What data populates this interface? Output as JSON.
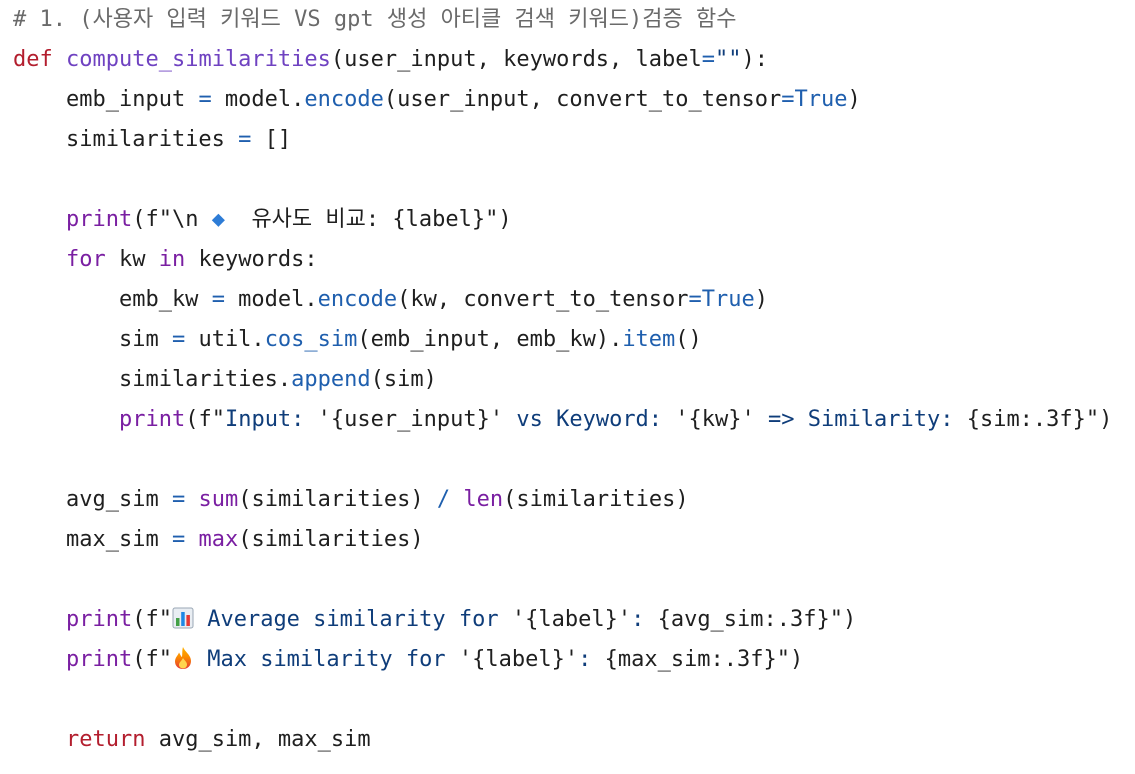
{
  "editor": {
    "lines": [
      {
        "tokens": [
          {
            "t": "# 1. (사용자 입력 키워드 VS gpt 생성 아티클 검색 키워드)검증 함수",
            "c": "comment"
          }
        ]
      },
      {
        "tokens": [
          {
            "t": "def",
            "c": "keyword"
          },
          {
            "t": " ",
            "c": "plain"
          },
          {
            "t": "compute_similarities",
            "c": "funcdef"
          },
          {
            "t": "(user_input, keywords, label",
            "c": "plain"
          },
          {
            "t": "=",
            "c": "operator"
          },
          {
            "t": "\"\"",
            "c": "string"
          },
          {
            "t": "):",
            "c": "plain"
          }
        ]
      },
      {
        "tokens": [
          {
            "t": "    emb_input ",
            "c": "plain"
          },
          {
            "t": "=",
            "c": "operator"
          },
          {
            "t": " model.",
            "c": "plain"
          },
          {
            "t": "encode",
            "c": "method"
          },
          {
            "t": "(user_input, convert_to_tensor",
            "c": "plain"
          },
          {
            "t": "=",
            "c": "operator"
          },
          {
            "t": "True",
            "c": "constant"
          },
          {
            "t": ")",
            "c": "plain"
          }
        ]
      },
      {
        "tokens": [
          {
            "t": "    similarities ",
            "c": "plain"
          },
          {
            "t": "=",
            "c": "operator"
          },
          {
            "t": " []",
            "c": "plain"
          }
        ]
      },
      {
        "tokens": [
          {
            "t": "",
            "c": "plain"
          }
        ]
      },
      {
        "tokens": [
          {
            "t": "    ",
            "c": "plain"
          },
          {
            "t": "print",
            "c": "builtin"
          },
          {
            "t": "(f\"\\n ",
            "c": "plain"
          },
          {
            "t": "◆",
            "c": "icon",
            "icon": "diamond-icon"
          },
          {
            "t": "  유사도 비교: {label}\")",
            "c": "plain"
          }
        ]
      },
      {
        "tokens": [
          {
            "t": "    ",
            "c": "plain"
          },
          {
            "t": "for",
            "c": "control"
          },
          {
            "t": " kw ",
            "c": "plain"
          },
          {
            "t": "in",
            "c": "control"
          },
          {
            "t": " keywords:",
            "c": "plain"
          }
        ]
      },
      {
        "tokens": [
          {
            "t": "        emb_kw ",
            "c": "plain"
          },
          {
            "t": "=",
            "c": "operator"
          },
          {
            "t": " model.",
            "c": "plain"
          },
          {
            "t": "encode",
            "c": "method"
          },
          {
            "t": "(kw, convert_to_tensor",
            "c": "plain"
          },
          {
            "t": "=",
            "c": "operator"
          },
          {
            "t": "True",
            "c": "constant"
          },
          {
            "t": ")",
            "c": "plain"
          }
        ]
      },
      {
        "tokens": [
          {
            "t": "        sim ",
            "c": "plain"
          },
          {
            "t": "=",
            "c": "operator"
          },
          {
            "t": " util.",
            "c": "plain"
          },
          {
            "t": "cos_sim",
            "c": "method"
          },
          {
            "t": "(emb_input, emb_kw).",
            "c": "plain"
          },
          {
            "t": "item",
            "c": "method"
          },
          {
            "t": "()",
            "c": "plain"
          }
        ]
      },
      {
        "tokens": [
          {
            "t": "        similarities.",
            "c": "plain"
          },
          {
            "t": "append",
            "c": "method"
          },
          {
            "t": "(sim)",
            "c": "plain"
          }
        ]
      },
      {
        "tokens": [
          {
            "t": "        ",
            "c": "plain"
          },
          {
            "t": "print",
            "c": "builtin"
          },
          {
            "t": "(f\"",
            "c": "plain"
          },
          {
            "t": "Input: ",
            "c": "string"
          },
          {
            "t": "'{user_input}'",
            "c": "plain"
          },
          {
            "t": " vs Keyword: ",
            "c": "string"
          },
          {
            "t": "'{kw}'",
            "c": "plain"
          },
          {
            "t": " => Similarity: ",
            "c": "string"
          },
          {
            "t": "{sim:.3f}\")",
            "c": "plain"
          }
        ]
      },
      {
        "tokens": [
          {
            "t": "",
            "c": "plain"
          }
        ]
      },
      {
        "tokens": [
          {
            "t": "    avg_sim ",
            "c": "plain"
          },
          {
            "t": "=",
            "c": "operator"
          },
          {
            "t": " ",
            "c": "plain"
          },
          {
            "t": "sum",
            "c": "builtin"
          },
          {
            "t": "(similarities) ",
            "c": "plain"
          },
          {
            "t": "/",
            "c": "operator"
          },
          {
            "t": " ",
            "c": "plain"
          },
          {
            "t": "len",
            "c": "builtin"
          },
          {
            "t": "(similarities)",
            "c": "plain"
          }
        ]
      },
      {
        "tokens": [
          {
            "t": "    max_sim ",
            "c": "plain"
          },
          {
            "t": "=",
            "c": "operator"
          },
          {
            "t": " ",
            "c": "plain"
          },
          {
            "t": "max",
            "c": "builtin"
          },
          {
            "t": "(similarities)",
            "c": "plain"
          }
        ]
      },
      {
        "tokens": [
          {
            "t": "",
            "c": "plain"
          }
        ]
      },
      {
        "tokens": [
          {
            "t": "    ",
            "c": "plain"
          },
          {
            "t": "print",
            "c": "builtin"
          },
          {
            "t": "(f\"",
            "c": "plain"
          },
          {
            "t": "",
            "c": "emoji",
            "icon": "bar-chart-icon"
          },
          {
            "t": " Average similarity for ",
            "c": "string"
          },
          {
            "t": "'{label}'",
            "c": "plain"
          },
          {
            "t": ": ",
            "c": "string"
          },
          {
            "t": "{avg_sim:.3f}\")",
            "c": "plain"
          }
        ]
      },
      {
        "tokens": [
          {
            "t": "    ",
            "c": "plain"
          },
          {
            "t": "print",
            "c": "builtin"
          },
          {
            "t": "(f\"",
            "c": "plain"
          },
          {
            "t": "",
            "c": "emoji",
            "icon": "fire-icon"
          },
          {
            "t": " Max similarity for ",
            "c": "string"
          },
          {
            "t": "'{label}'",
            "c": "plain"
          },
          {
            "t": ": ",
            "c": "string"
          },
          {
            "t": "{max_sim:.3f}\")",
            "c": "plain"
          }
        ]
      },
      {
        "tokens": [
          {
            "t": "",
            "c": "plain"
          }
        ]
      },
      {
        "tokens": [
          {
            "t": "    ",
            "c": "plain"
          },
          {
            "t": "return",
            "c": "keyword"
          },
          {
            "t": " avg_sim, max_sim",
            "c": "plain"
          }
        ]
      }
    ]
  },
  "colors": {
    "comment": "#6a6a6a",
    "keyword": "#b31e2e",
    "control": "#7a1fa2",
    "funcdef": "#6f42c1",
    "builtin": "#7a1fa2",
    "method": "#1f5fae",
    "operator": "#1f5fae",
    "constant": "#1f5fae",
    "string": "#0f3d7a",
    "plain": "#1f1f1f",
    "background": "#ffffff"
  }
}
